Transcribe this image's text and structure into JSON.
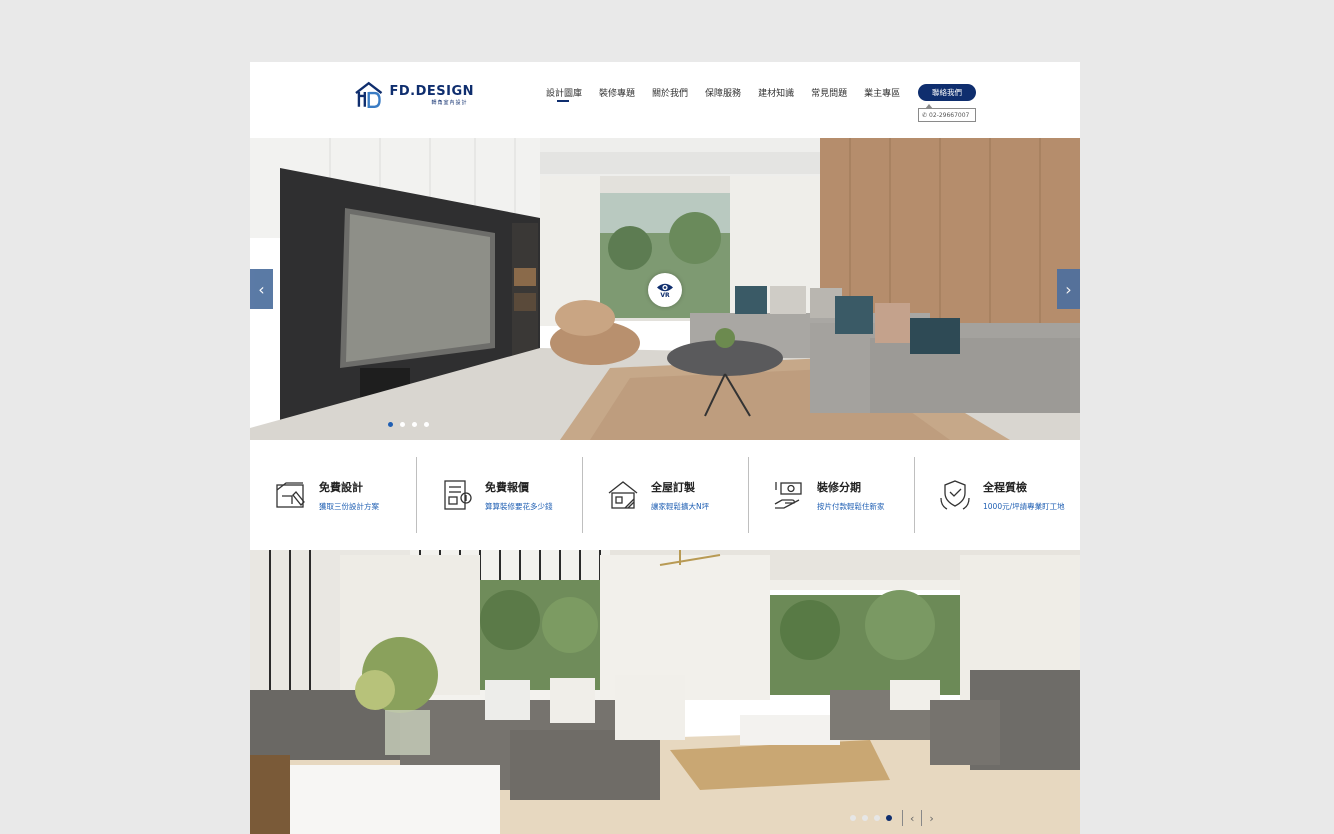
{
  "header": {
    "logo_title": "FD.DESIGN",
    "logo_subtitle": "轉角室內設計",
    "nav": [
      "設計圖庫",
      "裝修專題",
      "關於我們",
      "保障服務",
      "建材知識",
      "常見問題",
      "業主專區"
    ],
    "active_nav_index": 0,
    "contact_label": "聯絡我們",
    "phone": "02-29667007"
  },
  "hero": {
    "vr_label": "VR",
    "slide_count": 4,
    "active_slide": 0,
    "prev_icon": "chevron-left-icon",
    "next_icon": "chevron-right-icon"
  },
  "features": [
    {
      "title": "免費設計",
      "subtitle": "獲取三份設計方案",
      "icon": "design-plan-icon"
    },
    {
      "title": "免費報價",
      "subtitle": "算算裝修要花多少錢",
      "icon": "quote-calculator-icon"
    },
    {
      "title": "全屋訂製",
      "subtitle": "讓家輕鬆擴大N坪",
      "icon": "house-custom-icon"
    },
    {
      "title": "裝修分期",
      "subtitle": "按片付款輕鬆住新家",
      "icon": "installment-money-icon"
    },
    {
      "title": "全程質檢",
      "subtitle": "1000元/坪請專業盯工地",
      "icon": "shield-inspection-icon"
    }
  ],
  "bottom_slider": {
    "slide_count": 4,
    "active_slide": 3,
    "prev_icon": "chevron-left-icon",
    "next_icon": "chevron-right-icon"
  },
  "colors": {
    "brand": "#0f2e6e",
    "accent_blue": "#1f5fb3",
    "page_bg": "#e9e9e9"
  }
}
